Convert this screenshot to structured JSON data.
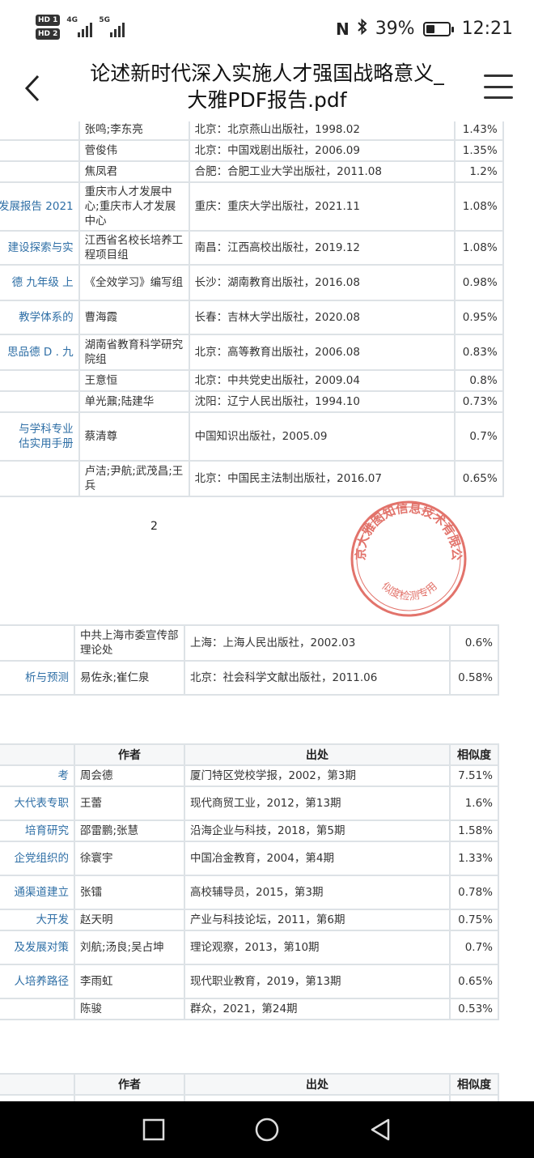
{
  "status_bar": {
    "hd1": "HD 1",
    "hd2": "HD 2",
    "net1": "4G",
    "net2": "5G",
    "battery_percent": "39%",
    "battery_level": 0.39,
    "time": "12:21",
    "icons": [
      "nfc-icon",
      "bluetooth-icon",
      "battery-icon",
      "signal-icon"
    ]
  },
  "header": {
    "title_line1": "论述新时代深入实施人才强国战略意义_",
    "title_line2": "大雅PDF报告.pdf"
  },
  "table1": {
    "rows": [
      {
        "title": "",
        "author": "张鸣;李东亮",
        "source": "北京：北京燕山出版社，1998.02",
        "similarity": "1.43%"
      },
      {
        "title": "",
        "author": "菅俊伟",
        "source": "北京：中国戏剧出版社，2006.09",
        "similarity": "1.35%"
      },
      {
        "title": "",
        "author": "焦凤君",
        "source": "合肥：合肥工业大学出版社，2011.08",
        "similarity": "1.2%"
      },
      {
        "title": "发展报告 2021",
        "author": "重庆市人才发展中心;重庆市人才发展中心",
        "source": "重庆：重庆大学出版社，2021.11",
        "similarity": "1.08%"
      },
      {
        "title": "建设探索与实",
        "author": "江西省名校长培养工程项目组",
        "source": "南昌：江西高校出版社，2019.12",
        "similarity": "1.08%"
      },
      {
        "title": "德 九年级 上",
        "author": "《全效学习》编写组",
        "source": "长沙：湖南教育出版社，2016.08",
        "similarity": "0.98%"
      },
      {
        "title": "教学体系的",
        "author": "曹海霞",
        "source": "长春：吉林大学出版社，2020.08",
        "similarity": "0.95%"
      },
      {
        "title": "思品德 D . 九",
        "author": "湖南省教育科学研究院组",
        "source": "北京：高等教育出版社，2006.08",
        "similarity": "0.83%"
      },
      {
        "title": "",
        "author": "王意恒",
        "source": "北京：中共党史出版社，2009.04",
        "similarity": "0.8%"
      },
      {
        "title": "",
        "author": "单光鼐;陆建华",
        "source": "沈阳：辽宁人民出版社，1994.10",
        "similarity": "0.73%"
      },
      {
        "title": "与学科专业\n估实用手册",
        "author": "蔡清尊",
        "source": "中国知识出版社，2005.09",
        "similarity": "0.7%"
      },
      {
        "title": "",
        "author": "卢洁;尹航;武茂昌;王兵",
        "source": "北京：中国民主法制出版社，2016.07",
        "similarity": "0.65%"
      }
    ]
  },
  "page_number": "2",
  "table2": {
    "rows": [
      {
        "title": "",
        "author": "中共上海市委宣传部理论处",
        "source": "上海：上海人民出版社，2002.03",
        "similarity": "0.6%"
      },
      {
        "title": "析与预测",
        "author": "易佐永;崔仁泉",
        "source": "北京：社会科学文献出版社，2011.06",
        "similarity": "0.58%"
      }
    ]
  },
  "table3": {
    "headers": {
      "author": "作者",
      "source": "出处",
      "similarity": "相似度"
    },
    "rows": [
      {
        "title": "考",
        "author": "周会德",
        "source": "厦门特区党校学报，2002，第3期",
        "similarity": "7.51%"
      },
      {
        "title": "大代表专职",
        "author": "王蕾",
        "source": "现代商贸工业，2012，第13期",
        "similarity": "1.6%"
      },
      {
        "title": "培育研究",
        "author": "邵雷鹏;张慧",
        "source": "沿海企业与科技，2018，第5期",
        "similarity": "1.58%"
      },
      {
        "title": "企党组织的",
        "author": "徐寰宇",
        "source": "中国冶金教育，2004，第4期",
        "similarity": "1.33%"
      },
      {
        "title": "通渠道建立",
        "author": "张镭",
        "source": "高校辅导员，2015，第3期",
        "similarity": "0.78%"
      },
      {
        "title": "大开发",
        "author": "赵天明",
        "source": "产业与科技论坛，2011，第6期",
        "similarity": "0.75%"
      },
      {
        "title": "及发展对策",
        "author": "刘航;汤良;吴占坤",
        "source": "理论观察，2013，第10期",
        "similarity": "0.7%"
      },
      {
        "title": "人培养路径",
        "author": "李雨虹",
        "source": "现代职业教育，2019，第13期",
        "similarity": "0.65%"
      },
      {
        "title": "",
        "author": "陈骏",
        "source": "群众，2021，第24期",
        "similarity": "0.53%"
      }
    ]
  },
  "table4": {
    "headers": {
      "author": "作者",
      "source": "出处",
      "similarity": "相似度"
    }
  },
  "stamp": {
    "outer_text": "北京大雅图知信息技术有限公司",
    "inner_text": "相似度检测专用章",
    "color": "#d9453a"
  },
  "nav": {
    "icons": [
      "recents-square-icon",
      "home-circle-icon",
      "back-triangle-icon"
    ]
  }
}
